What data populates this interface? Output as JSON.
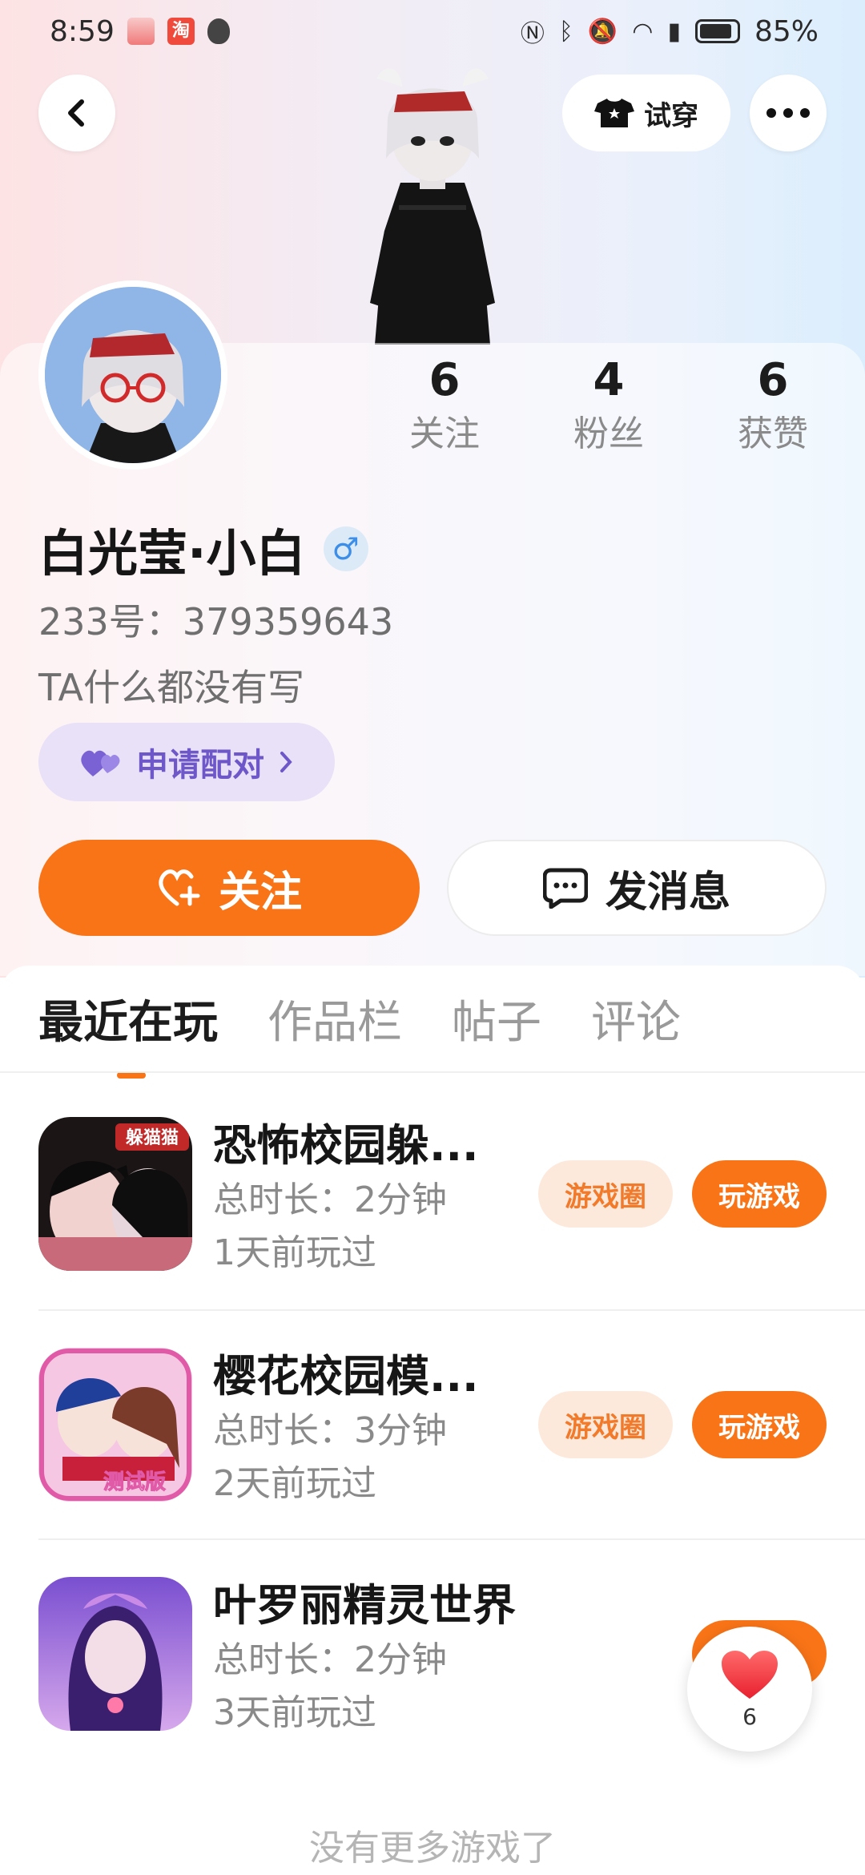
{
  "status_bar": {
    "time": "8:59",
    "taobao_badge": "淘",
    "battery": "85%"
  },
  "header": {
    "tryon_label": "试穿"
  },
  "profile": {
    "stats": [
      {
        "value": "6",
        "label": "关注"
      },
      {
        "value": "4",
        "label": "粉丝"
      },
      {
        "value": "6",
        "label": "获赞"
      }
    ],
    "name": "白光莹·小白",
    "gender_symbol": "♂",
    "uid": "233号：379359643",
    "bio": "TA什么都没有写",
    "pair_label": "申请配对",
    "follow_label": "关注",
    "message_label": "发消息"
  },
  "tabs": [
    "最近在玩",
    "作品栏",
    "帖子",
    "评论"
  ],
  "games": [
    {
      "title": "恐怖校园躲...",
      "duration": "总时长：2分钟",
      "last_played": "1天前玩过",
      "circle_label": "游戏圈",
      "play_label": "玩游戏",
      "icon_badge": "躲猫猫"
    },
    {
      "title": "樱花校园模...",
      "duration": "总时长：3分钟",
      "last_played": "2天前玩过",
      "circle_label": "游戏圈",
      "play_label": "玩游戏",
      "icon_badge": "测试版"
    },
    {
      "title": "叶罗丽精灵世界",
      "duration": "总时长：2分钟",
      "last_played": "3天前玩过",
      "circle_label": "",
      "play_label": "",
      "icon_badge": ""
    }
  ],
  "end_note": "没有更多游戏了",
  "like_fab": {
    "count": "6"
  },
  "colors": {
    "accent": "#f97417",
    "pair_purple": "#6e57c9",
    "muted": "#8a8a8a"
  }
}
